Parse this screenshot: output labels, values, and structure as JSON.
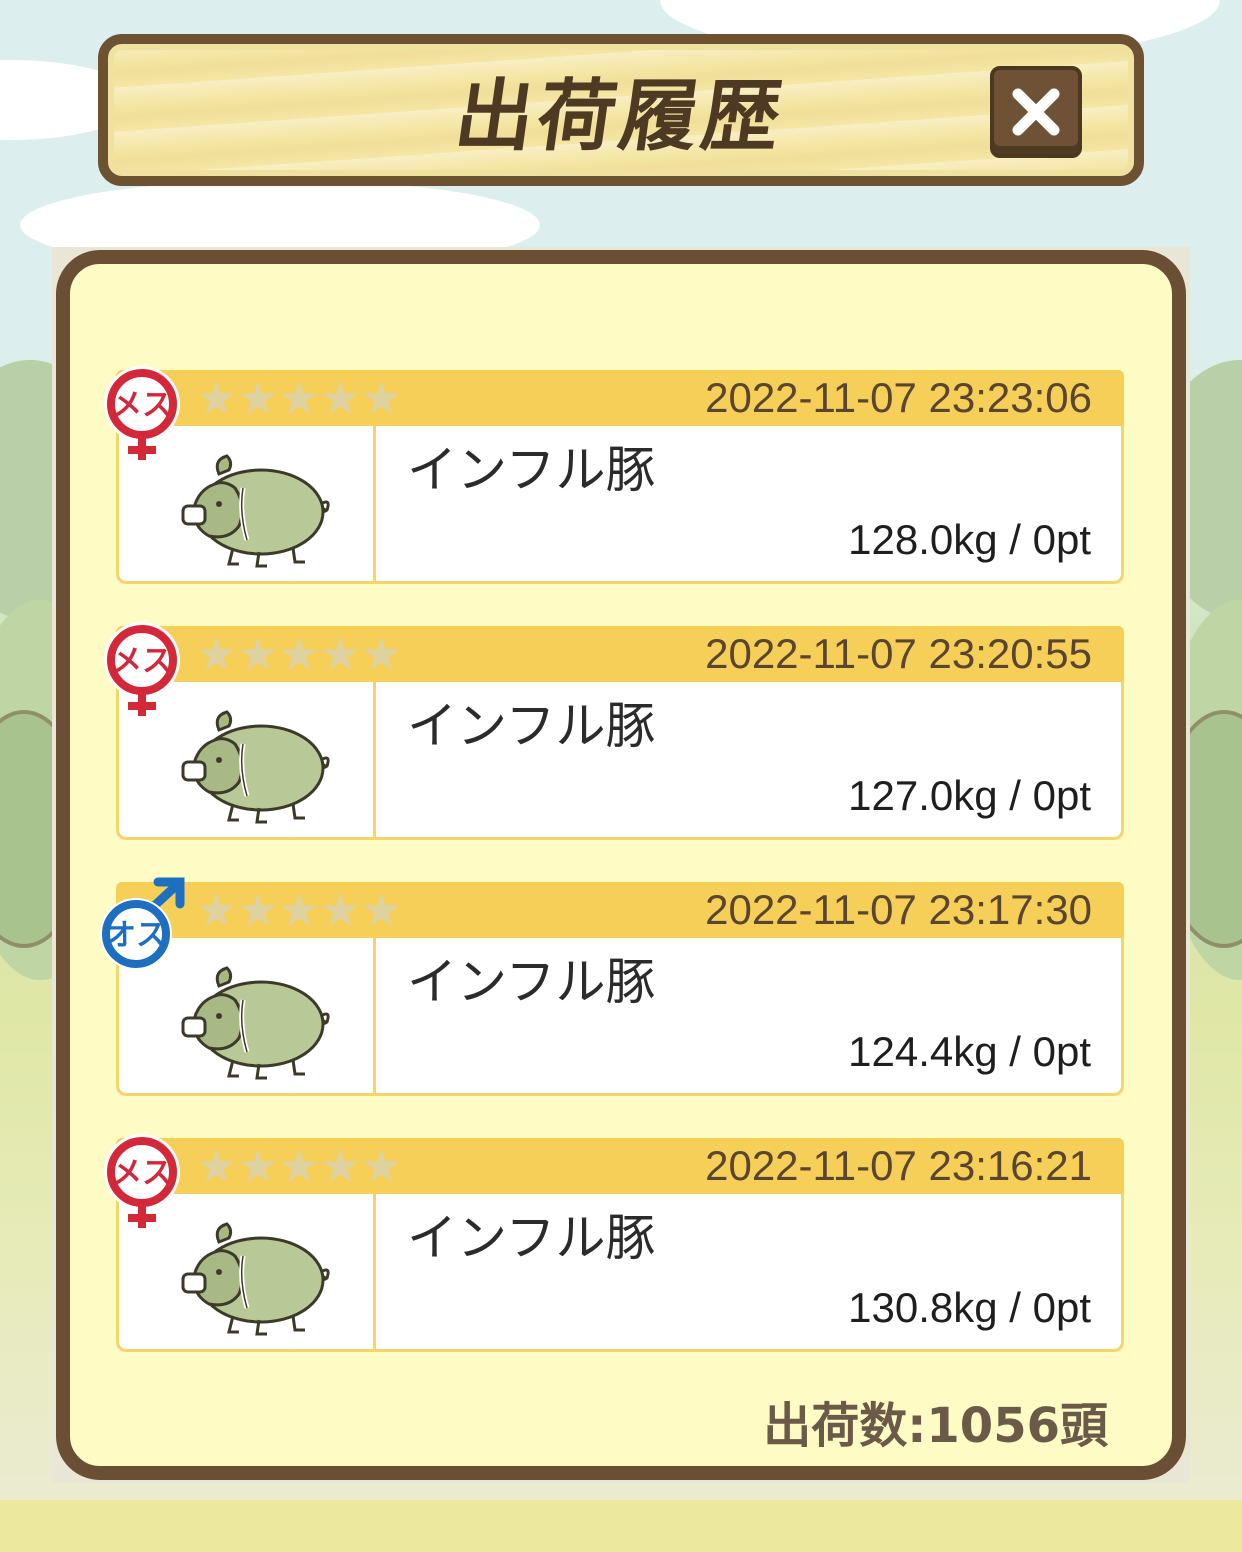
{
  "window": {
    "title": "出荷履歴"
  },
  "close_button": {
    "icon": "close-icon",
    "color": "#6f5236"
  },
  "records": [
    {
      "gender": "メス",
      "gender_icon": "female-icon",
      "stars": 5,
      "date": "2022-11-07 23:23:06",
      "name": "インフル豚",
      "weight": "128.0kg / 0pt"
    },
    {
      "gender": "メス",
      "gender_icon": "female-icon",
      "stars": 5,
      "date": "2022-11-07 23:20:55",
      "name": "インフル豚",
      "weight": "127.0kg / 0pt"
    },
    {
      "gender": "オス",
      "gender_icon": "male-icon",
      "stars": 5,
      "date": "2022-11-07 23:17:30",
      "name": "インフル豚",
      "weight": "124.4kg / 0pt"
    },
    {
      "gender": "メス",
      "gender_icon": "female-icon",
      "stars": 5,
      "date": "2022-11-07 23:16:21",
      "name": "インフル豚",
      "weight": "130.8kg / 0pt"
    }
  ],
  "footer": {
    "total_shipped": "出荷数:1056頭"
  },
  "colors": {
    "panel_border": "#6b4f34",
    "panel_fill": "#fffbc5",
    "header_bar": "#f5cf58",
    "female": "#d2283a",
    "male": "#1f6fc0"
  }
}
